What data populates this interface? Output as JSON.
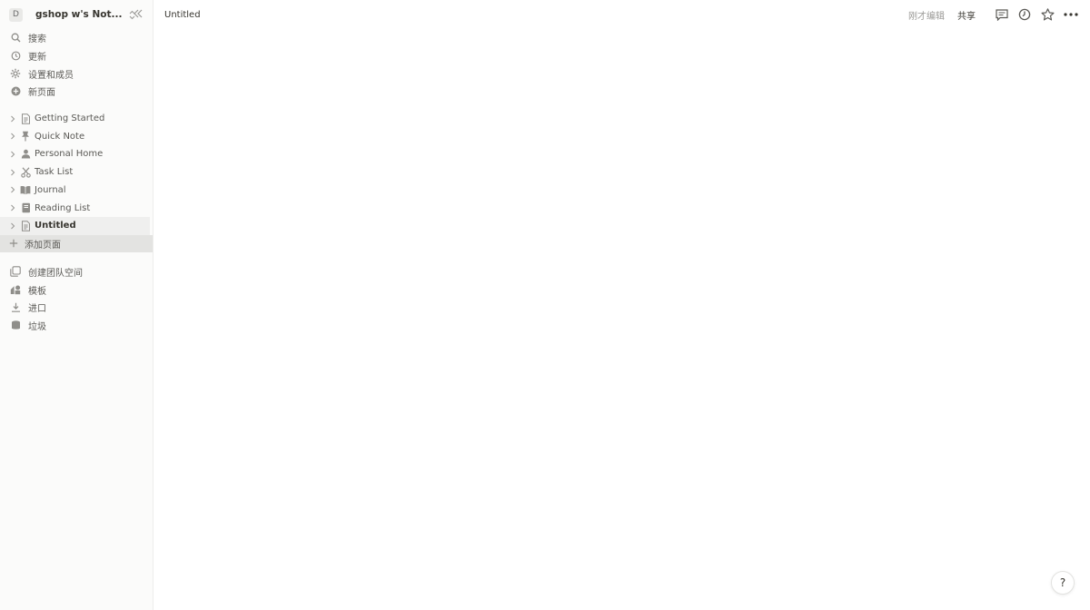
{
  "workspace": {
    "avatar_letter": "D",
    "name": "gshop w's Not..."
  },
  "menu": [
    {
      "label": "搜索",
      "icon": "search-icon"
    },
    {
      "label": "更新",
      "icon": "clock-icon"
    },
    {
      "label": "设置和成员",
      "icon": "gear-icon"
    },
    {
      "label": "新页面",
      "icon": "plus-circle-icon"
    }
  ],
  "pages": [
    {
      "label": "Getting Started",
      "icon": "document-icon"
    },
    {
      "label": "Quick Note",
      "icon": "pin-icon"
    },
    {
      "label": "Personal Home",
      "icon": "person-icon"
    },
    {
      "label": "Task List",
      "icon": "scissors-icon"
    },
    {
      "label": "Journal",
      "icon": "book-icon"
    },
    {
      "label": "Reading List",
      "icon": "notebook-icon"
    },
    {
      "label": "Untitled",
      "icon": "document-icon"
    }
  ],
  "add_page_label": "添加页面",
  "bottom_menu": [
    {
      "label": "创建团队空间",
      "icon": "team-space-icon"
    },
    {
      "label": "模板",
      "icon": "shapes-icon"
    },
    {
      "label": "进口",
      "icon": "download-icon"
    },
    {
      "label": "垃圾",
      "icon": "trash-icon"
    }
  ],
  "topbar": {
    "breadcrumb": "Untitled",
    "edited": "刚才编辑",
    "share": "共享"
  },
  "help_label": "?"
}
